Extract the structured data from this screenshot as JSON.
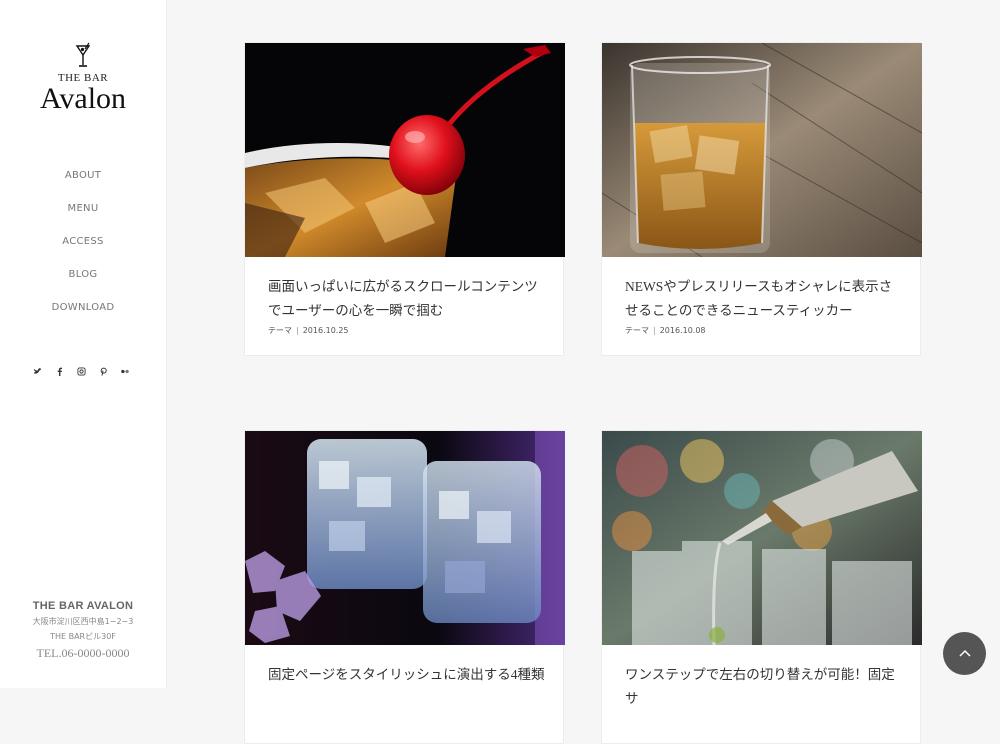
{
  "brand": {
    "sub": "THE BAR",
    "main": "Avalon"
  },
  "nav": [
    "ABOUT",
    "MENU",
    "ACCESS",
    "BLOG",
    "DOWNLOAD"
  ],
  "social": [
    {
      "icon": "twitter-icon",
      "glyph": "🐦"
    },
    {
      "icon": "facebook-icon",
      "glyph": "f"
    },
    {
      "icon": "instagram-icon",
      "glyph": "◎"
    },
    {
      "icon": "pinterest-icon",
      "glyph": "℗"
    },
    {
      "icon": "flickr-icon",
      "glyph": "••"
    }
  ],
  "footer": {
    "name": "THE BAR AVALON",
    "address": "大阪市淀川区西中島1−2−3",
    "building": "THE BARビル30F",
    "tel": "TEL.06-0000-0000"
  },
  "posts": [
    {
      "title": "画面いっぱいに広がるスクロールコンテンツでユーザーの心を一瞬で掴む",
      "category": "テーマ",
      "date": "2016.10.25"
    },
    {
      "title": "NEWSやプレスリリースもオシャレに表示させることのできるニュースティッカー",
      "category": "テーマ",
      "date": "2016.10.08"
    },
    {
      "title": "固定ページをスタイリッシュに演出する4種類",
      "category": "",
      "date": ""
    },
    {
      "title": "ワンステップで左右の切り替えが可能！固定サ",
      "category": "",
      "date": ""
    }
  ],
  "colors": {
    "sidebar_bg": "#ffffff",
    "page_bg": "#f6f6f7",
    "top_button": "#555555"
  }
}
